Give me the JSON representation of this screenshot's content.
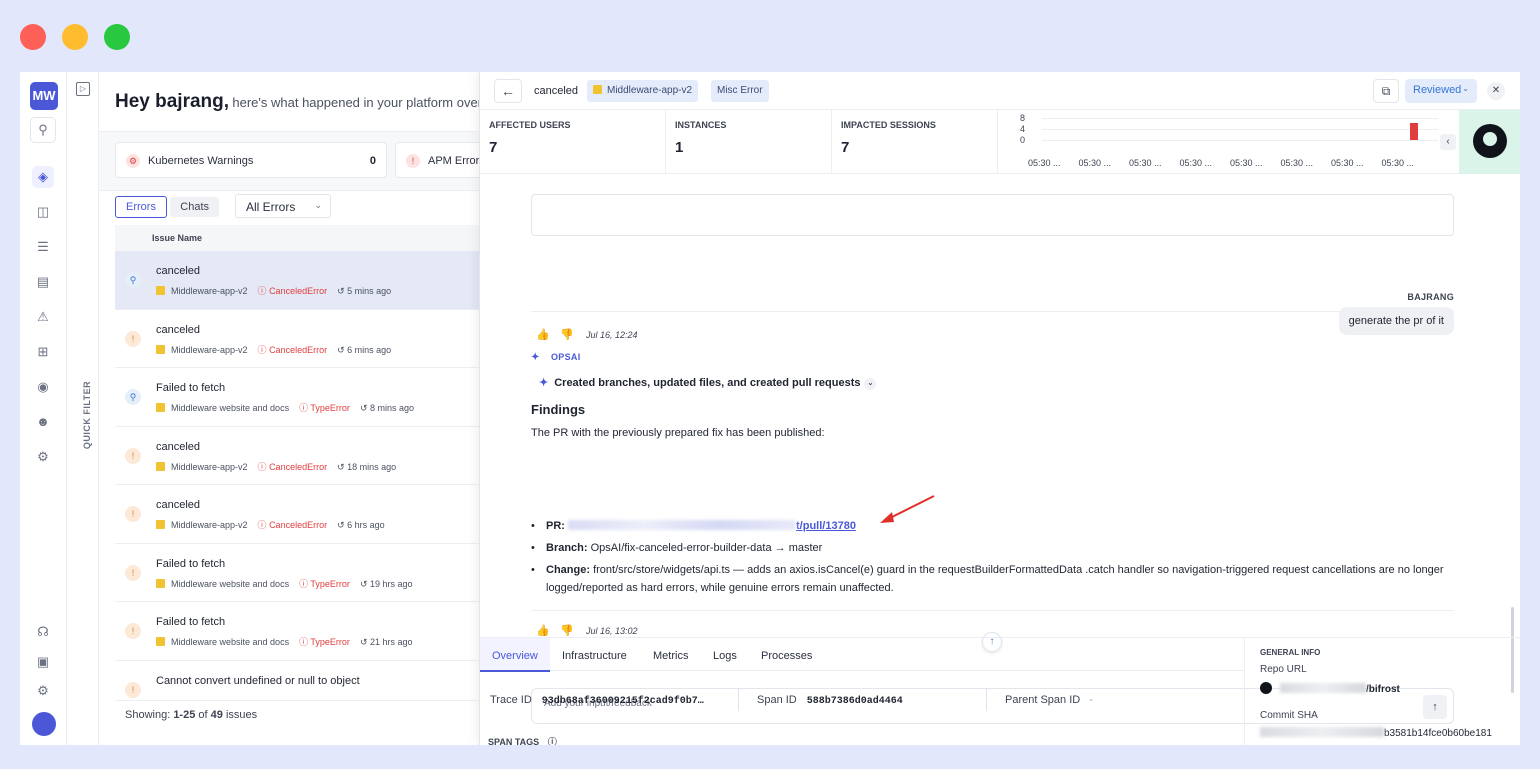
{
  "window_controls": {
    "close_color": "#fe5f57",
    "minimize_color": "#febc2e",
    "maximize_color": "#28c840"
  },
  "rail": {
    "logo": "MW",
    "icons": [
      "search-icon",
      "dashboard-icon",
      "database-icon",
      "logs-icon",
      "file-icon",
      "alert-icon",
      "widgets-add-icon",
      "bot-icon",
      "users-icon",
      "settings-icon",
      "headset-icon",
      "package-icon",
      "gear-icon",
      "avatar"
    ]
  },
  "quick_filter": {
    "label": "QUICK FILTER"
  },
  "main": {
    "greeting": "Hey bajrang,",
    "subtitle": "here's what happened in your platform over",
    "cards": [
      {
        "label": "Kubernetes Warnings",
        "count": "0"
      },
      {
        "label": "APM Errors",
        "count": ""
      }
    ],
    "tabs": [
      "Errors",
      "Chats"
    ],
    "filter": "All Errors",
    "column": "Issue Name",
    "issues": [
      {
        "title": "canceled",
        "app": "Middleware-app-v2",
        "error": "CanceledError",
        "time": "5 mins ago",
        "icon": "q",
        "selected": true
      },
      {
        "title": "canceled",
        "app": "Middleware-app-v2",
        "error": "CanceledError",
        "time": "6 mins ago",
        "icon": "w"
      },
      {
        "title": "Failed to fetch",
        "app": "Middleware website and docs",
        "error": "TypeError",
        "time": "8 mins ago",
        "icon": "q"
      },
      {
        "title": "canceled",
        "app": "Middleware-app-v2",
        "error": "CanceledError",
        "time": "18 mins ago",
        "icon": "w"
      },
      {
        "title": "canceled",
        "app": "Middleware-app-v2",
        "error": "CanceledError",
        "time": "6 hrs ago",
        "icon": "w"
      },
      {
        "title": "Failed to fetch",
        "app": "Middleware website and docs",
        "error": "TypeError",
        "time": "19 hrs ago",
        "icon": "w"
      },
      {
        "title": "Failed to fetch",
        "app": "Middleware website and docs",
        "error": "TypeError",
        "time": "21 hrs ago",
        "icon": "w"
      },
      {
        "title": "Cannot convert undefined or null to object",
        "app": "",
        "error": "",
        "time": "",
        "icon": "w"
      }
    ],
    "showing": {
      "prefix": "Showing: ",
      "range": "1-25",
      "of": " of ",
      "total": "49",
      "suffix": " issues"
    }
  },
  "detail": {
    "title": "canceled",
    "chips": [
      "Middleware-app-v2",
      "Misc Error"
    ],
    "status": "Reviewed",
    "stats": [
      {
        "label": "AFFECTED USERS",
        "value": "7"
      },
      {
        "label": "INSTANCES",
        "value": "1"
      },
      {
        "label": "IMPACTED SESSIONS",
        "value": "7"
      }
    ],
    "mini_chart": {
      "y_ticks": [
        "8",
        "4",
        "0"
      ],
      "x_ticks": [
        "05:30 ...",
        "05:30 ...",
        "05:30 ...",
        "05:30 ...",
        "05:30 ...",
        "05:30 ...",
        "05:30 ...",
        "05:30 ..."
      ],
      "last_value_fraction": 0.55
    }
  },
  "chat": {
    "reaction1_time": "Jul 16, 12:24",
    "user_name": "BAJRANG",
    "user_message": "generate the pr of it",
    "ai_name": "OPSAI",
    "ai_step": "Created branches, updated files, and created pull requests",
    "findings_title": "Findings",
    "findings_intro": "The PR with the previously prepared fix has been published:",
    "pr_label": "PR:",
    "pr_link": "t/pull/13780",
    "branch_label": "Branch:",
    "branch_value": "OpsAI/fix-canceled-error-builder-data → master",
    "change_label": "Change:",
    "change_value": "front/src/store/widgets/api.ts — adds an axios.isCancel(e) guard in the requestBuilderFormattedData .catch handler so navigation-triggered request cancellations are no longer logged/reported as hard errors, while genuine errors remain unaffected.",
    "reaction2_time": "Jul 16, 13:02",
    "input_placeholder": "Add your input/feedback"
  },
  "bottom": {
    "tabs": [
      "Overview",
      "Infrastructure",
      "Metrics",
      "Logs",
      "Processes"
    ],
    "trace_id_label": "Trace ID",
    "trace_id": "93db68af36009215f2cad9f0b7…",
    "span_id_label": "Span ID",
    "span_id": "588b7386d0ad4464",
    "parent_span_label": "Parent Span ID",
    "parent_span_value": "-",
    "span_tags": "SPAN TAGS",
    "general_info": "GENERAL INFO",
    "repo_url_label": "Repo URL",
    "repo_url_suffix": "/bifrost",
    "commit_label": "Commit SHA",
    "commit_suffix": "b3581b14fce0b60be181"
  }
}
